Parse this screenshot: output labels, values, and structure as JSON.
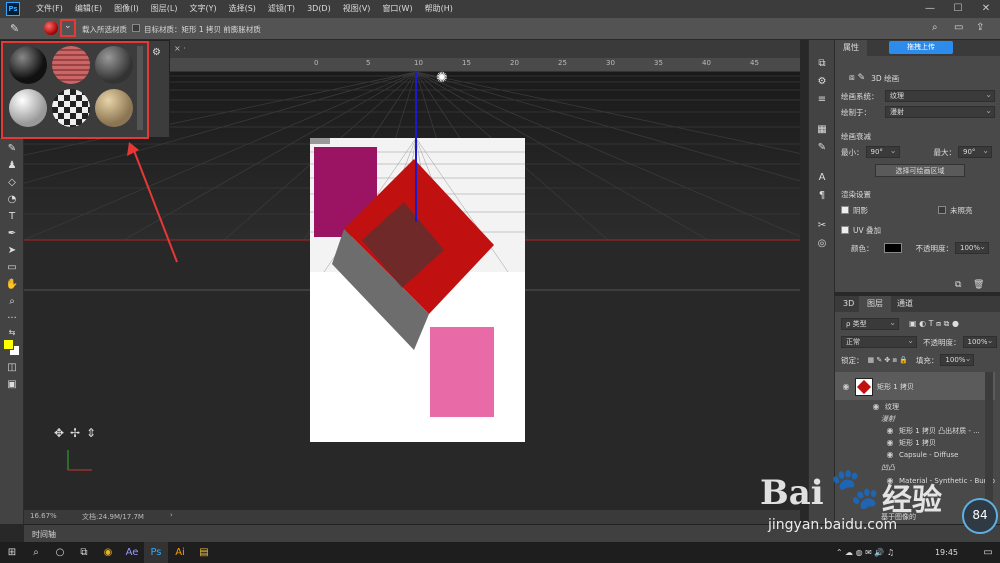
{
  "menu": {
    "logo": "Ps",
    "items": [
      "文件(F)",
      "编辑(E)",
      "图像(I)",
      "图层(L)",
      "文字(Y)",
      "选择(S)",
      "滤镜(T)",
      "3D(D)",
      "视图(V)",
      "窗口(W)",
      "帮助(H)"
    ],
    "min": "—",
    "max": "☐",
    "close": "✕"
  },
  "options": {
    "load_all": "载入所选材质",
    "target": "目标材质：矩形 1 拷贝 前膨胀材质"
  },
  "ruler": {
    "ticks": [
      "0",
      "5",
      "10",
      "15",
      "20",
      "25",
      "30",
      "35",
      "40",
      "45"
    ]
  },
  "popup": {
    "gear": "⚙"
  },
  "status": {
    "zoom": "16.67%",
    "doc": "文档:24.9M/17.7M",
    "arrow": "›"
  },
  "timeline": {
    "label": "时间轴"
  },
  "props": {
    "tab": "属性",
    "title": "3D 绘画",
    "paint_system_label": "绘画系统：",
    "paint_system": "纹理",
    "paint_on_label": "绘制于：",
    "paint_on": "漫射",
    "falloff_label": "绘画衰减",
    "min_label": "最小：",
    "min_val": "90°",
    "max_label": "最大：",
    "max_val": "90°",
    "select_btn": "选择可绘画区域",
    "render_label": "渲染设置",
    "shadow": "阴影",
    "unlit": "未照亮",
    "uv": "UV 叠加",
    "color_label": "颜色：",
    "opacity_label": "不透明度：",
    "opacity_val": "100%",
    "cloud_btn": "拖拽上传"
  },
  "layers": {
    "tabs": [
      "3D",
      "图层",
      "通道"
    ],
    "kind": "ρ 类型",
    "blend": "正常",
    "opacity_label": "不透明度：",
    "opacity": "100%",
    "lock_label": "锁定：",
    "fill_label": "填充：",
    "fill": "100%",
    "items": [
      {
        "name": "矩形 1 拷贝"
      },
      {
        "name": "纹理"
      },
      {
        "name": "漫射"
      },
      {
        "name": "矩形 1 拷贝 凸出材质 - ..."
      },
      {
        "name": "矩形 1 拷贝"
      },
      {
        "name": "Capsule - Diffuse"
      },
      {
        "name": "凹凸"
      },
      {
        "name": "Material - Synthetic - Bump"
      },
      {
        "name": "基于图像的"
      }
    ]
  },
  "taskbar": {
    "time": "19:45"
  },
  "watermark": {
    "brand": "Bai",
    "brand2": "经验",
    "url": "jingyan.baidu.com",
    "speed": "84",
    "pct": "%"
  },
  "colors": {
    "accent": "#e53935",
    "fg": "#ffff00",
    "bg": "#ffffff"
  }
}
